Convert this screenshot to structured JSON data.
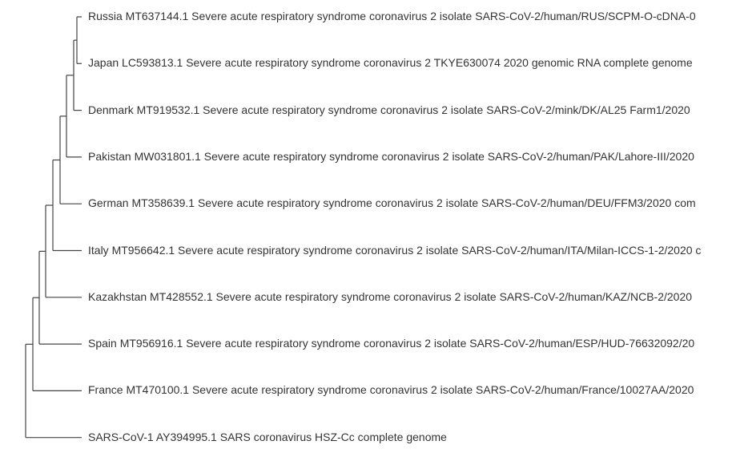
{
  "tree": {
    "type": "phylogenetic-tree",
    "line_color": "#444444",
    "leaves": [
      {
        "id": "russia",
        "label": "Russia MT637144.1 Severe acute respiratory syndrome coronavirus 2 isolate SARS-CoV-2/human/RUS/SCPM-O-cDNA-0"
      },
      {
        "id": "japan",
        "label": "Japan LC593813.1 Severe acute respiratory syndrome coronavirus 2 TKYE630074 2020 genomic RNA complete genome"
      },
      {
        "id": "denmark",
        "label": "Denmark MT919532.1 Severe acute respiratory syndrome coronavirus 2 isolate SARS-CoV-2/mink/DK/AL25 Farm1/2020"
      },
      {
        "id": "pakistan",
        "label": "Pakistan MW031801.1 Severe acute respiratory syndrome coronavirus 2 isolate SARS-CoV-2/human/PAK/Lahore-III/2020"
      },
      {
        "id": "german",
        "label": "German MT358639.1 Severe acute respiratory syndrome coronavirus 2 isolate SARS-CoV-2/human/DEU/FFM3/2020 com"
      },
      {
        "id": "italy",
        "label": "Italy MT956642.1 Severe acute respiratory syndrome coronavirus 2 isolate SARS-CoV-2/human/ITA/Milan-ICCS-1-2/2020 c"
      },
      {
        "id": "kazakhstan",
        "label": "Kazakhstan MT428552.1 Severe acute respiratory syndrome coronavirus 2 isolate SARS-CoV-2/human/KAZ/NCB-2/2020"
      },
      {
        "id": "spain",
        "label": "Spain MT956916.1 Severe acute respiratory syndrome coronavirus 2 isolate SARS-CoV-2/human/ESP/HUD-76632092/20"
      },
      {
        "id": "france",
        "label": "France MT470100.1 Severe acute respiratory syndrome coronavirus 2 isolate SARS-CoV-2/human/France/10027AA/2020"
      },
      {
        "id": "sars1",
        "label": "SARS-CoV-1 AY394995.1 SARS coronavirus HSZ-Cc complete genome"
      }
    ],
    "newick": "((((((((((russia,japan),denmark),pakistan),german),italy),kazakhstan),spain),france),sars1))"
  }
}
